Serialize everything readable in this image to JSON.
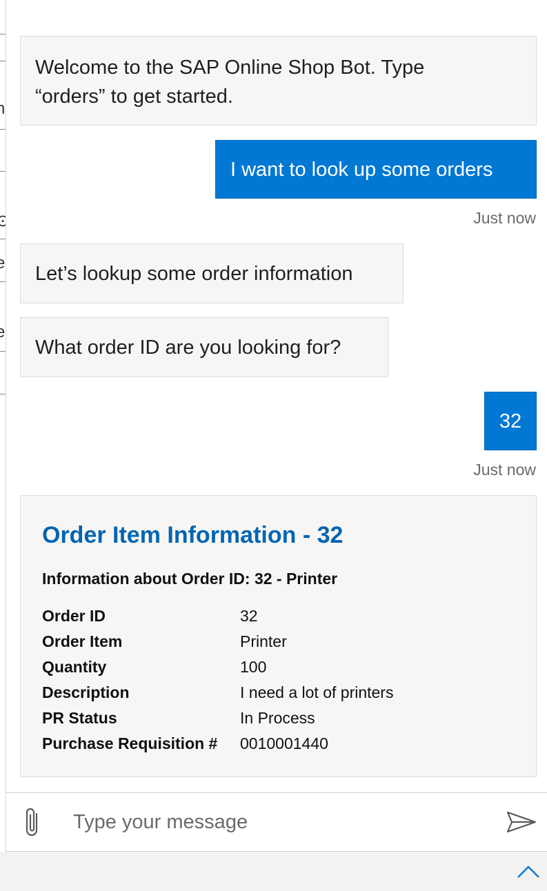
{
  "messages": [
    {
      "from": "bot",
      "text_line1": "Welcome to the SAP Online Shop Bot. Type",
      "text_line2": "“orders” to get started."
    },
    {
      "from": "user",
      "text": "I want to look up some orders",
      "timestamp": "Just now"
    },
    {
      "from": "bot",
      "text": "Let’s lookup some order information"
    },
    {
      "from": "bot",
      "text": "What order ID are you looking for?"
    },
    {
      "from": "user",
      "text": "32",
      "timestamp": "Just now"
    }
  ],
  "card": {
    "title": "Order Item Information - 32",
    "subtitle": "Information about Order ID: 32 - Printer",
    "facts": [
      {
        "key": "Order ID",
        "value": "32"
      },
      {
        "key": "Order Item",
        "value": "Printer"
      },
      {
        "key": "Quantity",
        "value": "100"
      },
      {
        "key": "Description",
        "value": "I need a lot of printers"
      },
      {
        "key": "PR Status",
        "value": "In Process"
      },
      {
        "key": "Purchase Requisition #",
        "value": "0010001440"
      }
    ]
  },
  "composer": {
    "placeholder": "Type your message",
    "attach_icon": "paperclip-icon",
    "send_icon": "send-icon"
  },
  "bottom_bar": {
    "icon": "chevron-up-icon"
  },
  "colors": {
    "user_bubble": "#0078d4",
    "bot_bubble": "#f7f6f5",
    "card_title": "#0065b3",
    "chevron": "#0078d4"
  }
}
